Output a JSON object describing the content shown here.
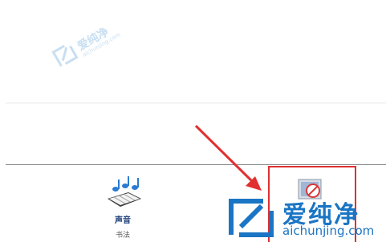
{
  "watermark": {
    "brand_cn": "爱纯净",
    "url": "aichunjing.com"
  },
  "control_panel": {
    "items": [
      {
        "label": "声音",
        "sublabel": "书法"
      }
    ]
  },
  "colors": {
    "arrow": "#e03030",
    "highlight": "#e03030",
    "logo_blue": "#1a75c4"
  }
}
